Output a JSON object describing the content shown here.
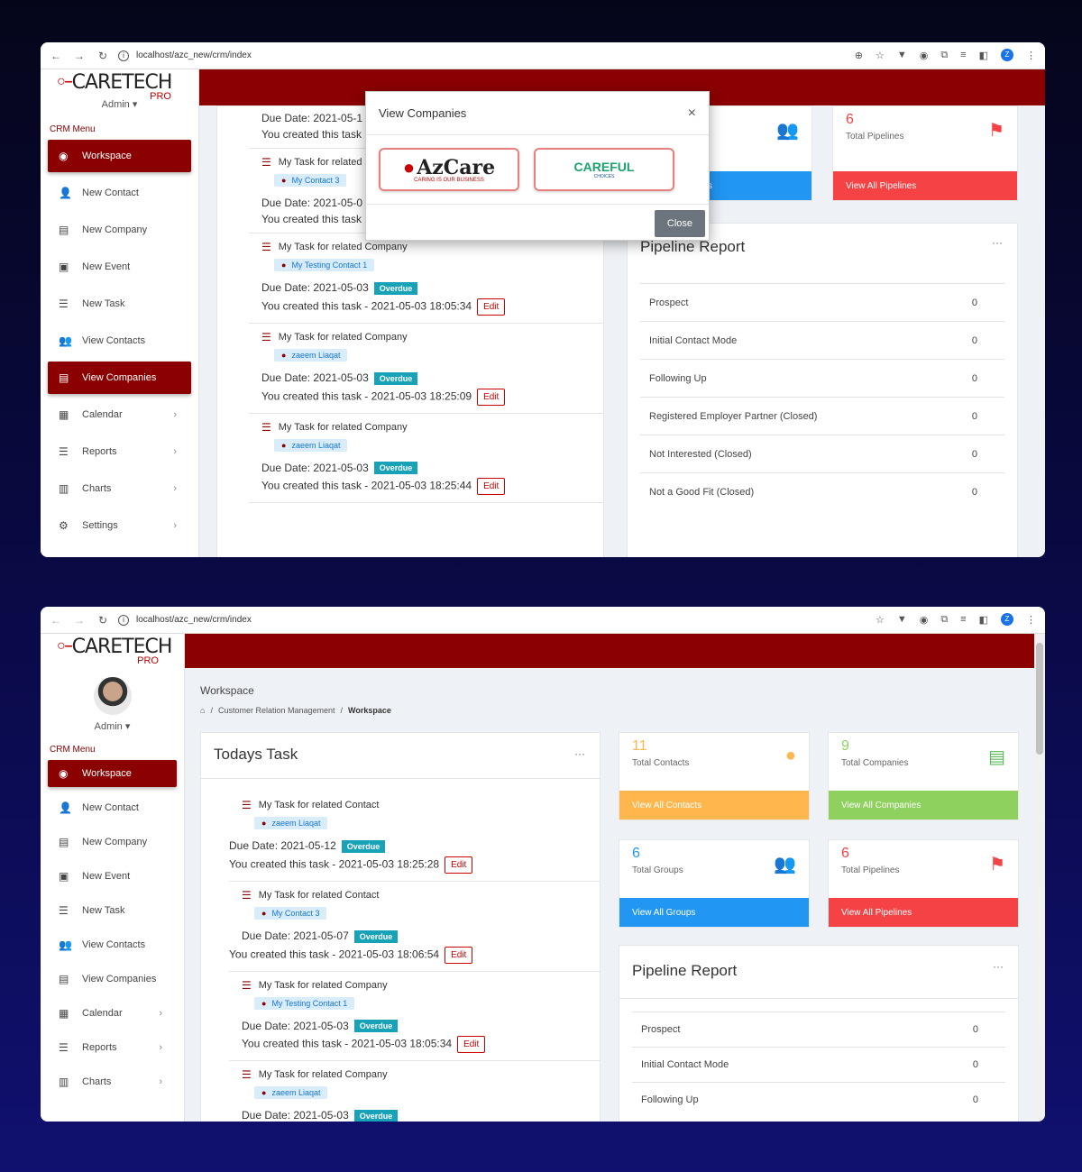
{
  "browser": {
    "url": "localhost/azc_new/crm/index"
  },
  "brand": {
    "name": "CARETECH",
    "sub": "PRO",
    "admin_label": "Admin ▾",
    "crm_menu": "CRM Menu"
  },
  "menu": [
    {
      "label": "Workspace",
      "icon": "dashboard-icon"
    },
    {
      "label": "New Contact",
      "icon": "user-plus-icon"
    },
    {
      "label": "New Company",
      "icon": "id-card-icon"
    },
    {
      "label": "New Event",
      "icon": "calendar-plus-icon"
    },
    {
      "label": "New Task",
      "icon": "tasks-icon"
    },
    {
      "label": "View Contacts",
      "icon": "users-icon"
    },
    {
      "label": "View Companies",
      "icon": "id-card-icon"
    },
    {
      "label": "Calendar",
      "icon": "calendar-icon"
    },
    {
      "label": "Reports",
      "icon": "list-icon"
    },
    {
      "label": "Charts",
      "icon": "bar-chart-icon"
    },
    {
      "label": "Settings",
      "icon": "gear-icon"
    }
  ],
  "shot1": {
    "tasks": [
      {
        "due": "Due Date: 2021-05-1",
        "created": "You created this task"
      },
      {
        "title": "My Task for related",
        "tag": "My Contact 3",
        "due": "Due Date: 2021-05-0",
        "created": "You created this task"
      },
      {
        "title": "My Task for related Company",
        "tag": "My Testing Contact 1",
        "due": "Due Date: 2021-05-03",
        "overdue": "Overdue",
        "created": "You created this task - 2021-05-03 18:05:34",
        "edit": "Edit"
      },
      {
        "title": "My Task for related Company",
        "tag": "zaeem Liaqat",
        "due": "Due Date: 2021-05-03",
        "overdue": "Overdue",
        "created": "You created this task - 2021-05-03 18:25:09",
        "edit": "Edit"
      },
      {
        "title": "My Task for related Company",
        "tag": "zaeem Liaqat",
        "due": "Due Date: 2021-05-03",
        "overdue": "Overdue",
        "created": "You created this task - 2021-05-03 18:25:44",
        "edit": "Edit"
      }
    ],
    "pipelines": {
      "num": "6",
      "label": "Total Pipelines",
      "link": "View All Pipelines"
    },
    "groups_link_fragment": "s",
    "modal": {
      "title": "View Companies",
      "close_x": "×",
      "company1": "AzCare",
      "company1_tag": "CARING IS OUR BUSINESS",
      "company2": "CAREFUL",
      "company2_tag": "CHOICES",
      "close_btn": "Close"
    },
    "pipeline_title": "Pipeline Report",
    "pipeline_rows": [
      {
        "name": "Prospect",
        "count": "0"
      },
      {
        "name": "Initial Contact Mode",
        "count": "0"
      },
      {
        "name": "Following Up",
        "count": "0"
      },
      {
        "name": "Registered Employer Partner (Closed)",
        "count": "0"
      },
      {
        "name": "Not Interested (Closed)",
        "count": "0"
      },
      {
        "name": "Not a Good Fit (Closed)",
        "count": "0"
      }
    ]
  },
  "shot2": {
    "page_title": "Workspace",
    "breadcrumb": {
      "home": "⌂",
      "sep": "/",
      "crm": "Customer Relation Management",
      "current": "Workspace"
    },
    "todays_task": "Todays Task",
    "dots": "···",
    "tasks": [
      {
        "title": "My Task for related Contact",
        "tag": "zaeem Liaqat",
        "due": "Due Date: 2021-05-12",
        "overdue": "Overdue",
        "created": "You created this task - 2021-05-03 18:25:28",
        "edit": "Edit"
      },
      {
        "title": "My Task for related Contact",
        "tag": "My Contact 3",
        "due": "Due Date: 2021-05-07",
        "overdue": "Overdue",
        "created": "You created this task - 2021-05-03 18:06:54",
        "edit": "Edit"
      },
      {
        "title": "My Task for related Company",
        "tag": "My Testing Contact 1",
        "due": "Due Date: 2021-05-03",
        "overdue": "Overdue",
        "created": "You created this task - 2021-05-03 18:05:34",
        "edit": "Edit"
      },
      {
        "title": "My Task for related Company",
        "tag": "zaeem Liaqat",
        "due": "Due Date: 2021-05-03",
        "overdue": "Overdue"
      }
    ],
    "stats": [
      {
        "num": "11",
        "label": "Total Contacts",
        "link": "View All Contacts",
        "color": "#ffb64d",
        "numcolor": "#ffb64d"
      },
      {
        "num": "9",
        "label": "Total Companies",
        "link": "View All Companies",
        "color": "#8ed15f",
        "numcolor": "#8ed15f"
      },
      {
        "num": "6",
        "label": "Total Groups",
        "link": "View All Groups",
        "color": "#2196f3",
        "numcolor": "#2196f3"
      },
      {
        "num": "6",
        "label": "Total Pipelines",
        "link": "View All Pipelines",
        "color": "#f44245",
        "numcolor": "#f44245"
      }
    ],
    "pipeline_title": "Pipeline Report",
    "pipeline_rows": [
      {
        "name": "Prospect",
        "count": "0"
      },
      {
        "name": "Initial Contact Mode",
        "count": "0"
      },
      {
        "name": "Following Up",
        "count": "0"
      }
    ]
  }
}
